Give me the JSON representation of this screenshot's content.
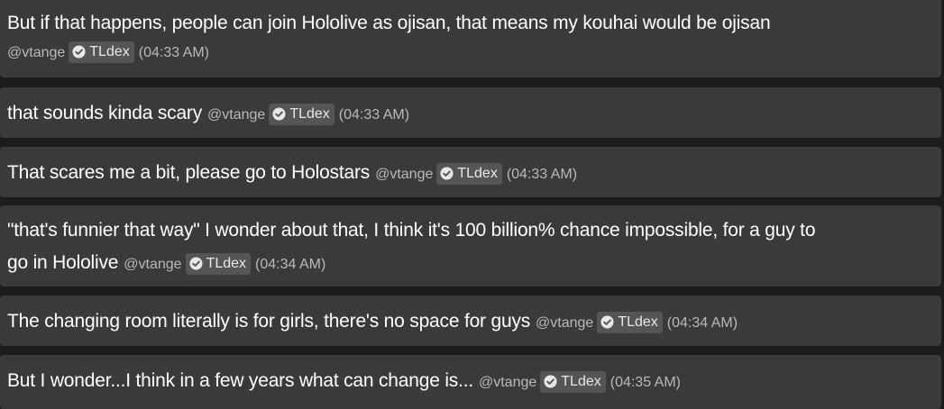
{
  "messages": [
    {
      "text": "But if that happens, people can join Hololive as ojisan, that means my kouhai would be ojisan",
      "handle": "@vtange",
      "badge": "TLdex",
      "time": "(04:33 AM)"
    },
    {
      "text": "that sounds kinda scary",
      "handle": "@vtange",
      "badge": "TLdex",
      "time": "(04:33 AM)"
    },
    {
      "text": "That scares me a bit, please go to Holostars",
      "handle": "@vtange",
      "badge": "TLdex",
      "time": "(04:33 AM)"
    },
    {
      "text_line1": "\"that's funnier that way\" I wonder about that, I think it's 100 billion% chance impossible, for a guy to",
      "text_line2": "go in Hololive",
      "handle": "@vtange",
      "badge": "TLdex",
      "time": "(04:34 AM)"
    },
    {
      "text": "The changing room literally is for girls, there's no space for guys",
      "handle": "@vtange",
      "badge": "TLdex",
      "time": "(04:34 AM)"
    },
    {
      "text": "But I wonder...I think in a few years what can change is...",
      "handle": "@vtange",
      "badge": "TLdex",
      "time": "(04:35 AM)"
    }
  ],
  "icons": {
    "badge_icon": "verified-check-icon"
  },
  "colors": {
    "background": "#1c1c1c",
    "card": "#3a3a3a",
    "badge": "#555555",
    "text": "#ffffff",
    "meta": "#b9b9b9"
  }
}
